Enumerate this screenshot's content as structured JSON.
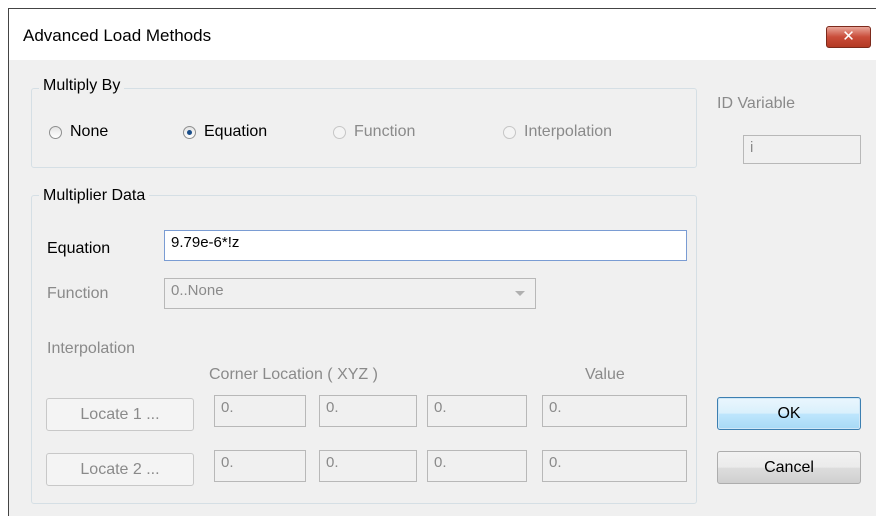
{
  "window": {
    "title": "Advanced Load Methods",
    "close_glyph": "✕"
  },
  "multiply_by": {
    "label": "Multiply By",
    "options": [
      {
        "label": "None",
        "checked": false,
        "enabled": true
      },
      {
        "label": "Equation",
        "checked": true,
        "enabled": true
      },
      {
        "label": "Function",
        "checked": false,
        "enabled": false
      },
      {
        "label": "Interpolation",
        "checked": false,
        "enabled": false
      }
    ]
  },
  "id_variable": {
    "label": "ID Variable",
    "value": "i"
  },
  "multiplier_data": {
    "label": "Multiplier Data",
    "equation_label": "Equation",
    "equation_value": "9.79e-6*!z",
    "function_label": "Function",
    "function_value": "0..None",
    "interpolation_label": "Interpolation",
    "corner_location_label": "Corner Location ( XYZ )",
    "value_label": "Value",
    "rows": [
      {
        "button": "Locate 1 ...",
        "x": "0.",
        "y": "0.",
        "z": "0.",
        "value": "0."
      },
      {
        "button": "Locate 2 ...",
        "x": "0.",
        "y": "0.",
        "z": "0.",
        "value": "0."
      }
    ]
  },
  "buttons": {
    "ok": "OK",
    "cancel": "Cancel"
  }
}
